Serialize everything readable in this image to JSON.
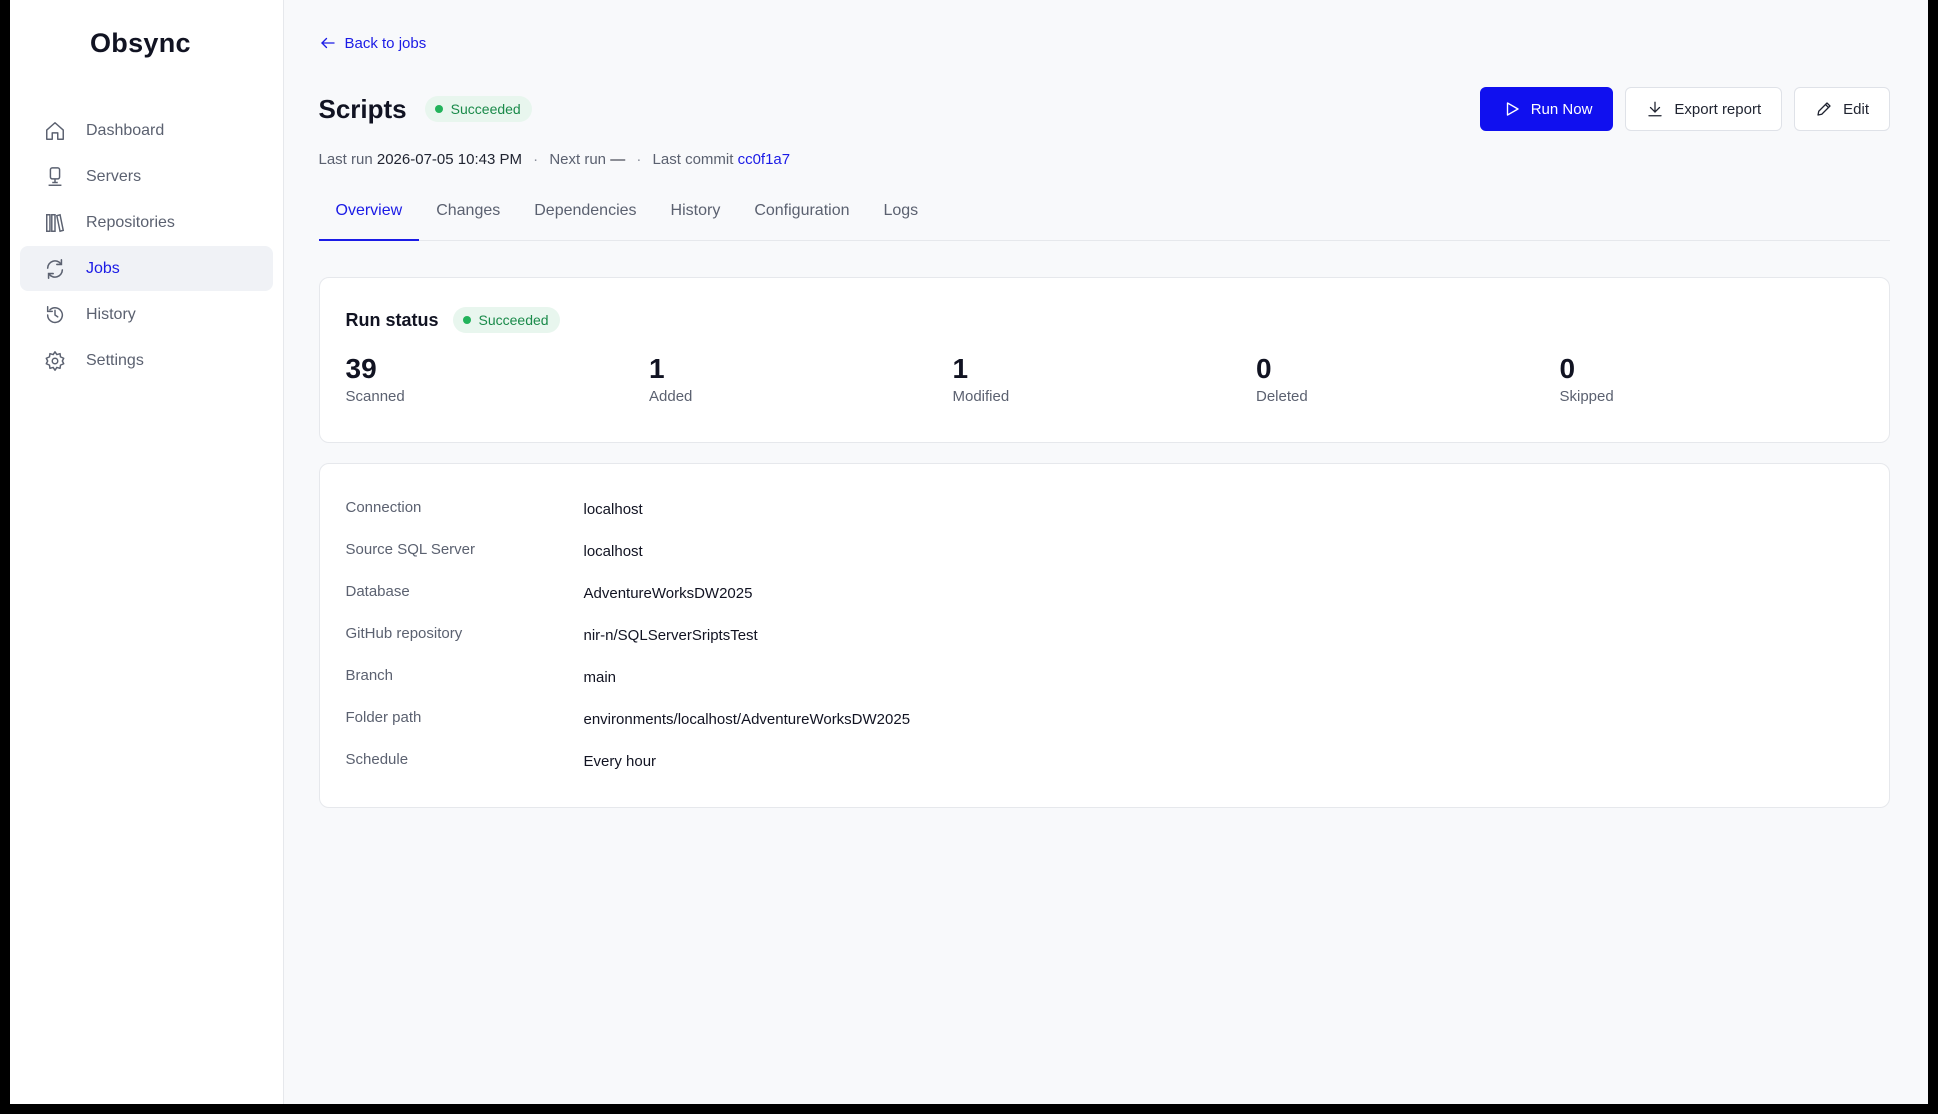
{
  "app": {
    "name": "Obsync"
  },
  "sidebar": {
    "items": [
      {
        "label": "Dashboard",
        "icon": "home-icon"
      },
      {
        "label": "Servers",
        "icon": "server-icon"
      },
      {
        "label": "Repositories",
        "icon": "repositories-icon"
      },
      {
        "label": "Jobs",
        "icon": "refresh-icon",
        "active": true
      },
      {
        "label": "History",
        "icon": "history-icon"
      },
      {
        "label": "Settings",
        "icon": "gear-icon"
      }
    ]
  },
  "header": {
    "back_label": "Back to jobs",
    "title": "Scripts",
    "status": "Succeeded",
    "actions": {
      "run_now": "Run Now",
      "export": "Export report",
      "edit": "Edit"
    },
    "meta": {
      "last_run_label": "Last run",
      "last_run_value": "2026-07-05 10:43 PM",
      "next_run_label": "Next run",
      "next_run_value": "—",
      "last_commit_label": "Last commit",
      "last_commit_value": "cc0f1a7"
    }
  },
  "tabs": [
    "Overview",
    "Changes",
    "Dependencies",
    "History",
    "Configuration",
    "Logs"
  ],
  "active_tab": "Overview",
  "run_status": {
    "title": "Run status",
    "badge": "Succeeded",
    "stats": [
      {
        "value": "39",
        "label": "Scanned"
      },
      {
        "value": "1",
        "label": "Added"
      },
      {
        "value": "1",
        "label": "Modified"
      },
      {
        "value": "0",
        "label": "Deleted"
      },
      {
        "value": "0",
        "label": "Skipped"
      }
    ]
  },
  "details": [
    {
      "label": "Connection",
      "value": "localhost"
    },
    {
      "label": "Source SQL Server",
      "value": "localhost"
    },
    {
      "label": "Database",
      "value": "AdventureWorksDW2025"
    },
    {
      "label": "GitHub repository",
      "value": "nir-n/SQLServerSriptsTest"
    },
    {
      "label": "Branch",
      "value": "main"
    },
    {
      "label": "Folder path",
      "value": "environments/localhost/AdventureWorksDW2025"
    },
    {
      "label": "Schedule",
      "value": "Every hour"
    }
  ],
  "colors": {
    "accent": "#1010ef",
    "success": "#1a8a4a",
    "success_bg": "#e8f6ee"
  }
}
